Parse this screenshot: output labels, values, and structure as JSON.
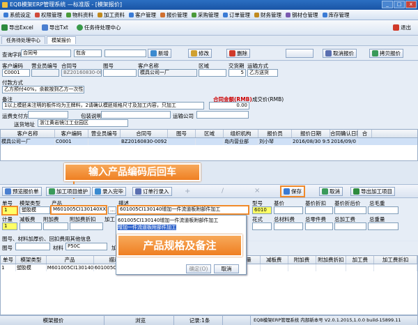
{
  "window": {
    "title": "EQB模架ERP管理系统 —标准版 - [模架报价]"
  },
  "menu": [
    {
      "label": "系统设定",
      "color": "#3a7bd5"
    },
    {
      "label": "权限管理",
      "color": "#d04a3a"
    },
    {
      "label": "物料资料",
      "color": "#4a9a3a"
    },
    {
      "label": "加工资料",
      "color": "#c08a20"
    },
    {
      "label": "客户管理",
      "color": "#3a7bd5"
    },
    {
      "label": "报价管理",
      "color": "#d07030"
    },
    {
      "label": "采购管理",
      "color": "#4a9a3a"
    },
    {
      "label": "订单管理",
      "color": "#3a7bd5"
    },
    {
      "label": "财务管理",
      "color": "#c08a20"
    },
    {
      "label": "钢材仓管理",
      "color": "#7a5ab0"
    },
    {
      "label": "库存管理",
      "color": "#3a7bd5"
    }
  ],
  "toolbar": {
    "export_excel": "导出Excel",
    "export_txt": "导出Txt",
    "task_center": "任务待处理中心",
    "exit": "退出"
  },
  "tabs": [
    "任务待处理中心",
    "模架报价"
  ],
  "query": {
    "label": "查询字段",
    "field": "合同号",
    "op": "包含",
    "value": "",
    "buttons": {
      "add": "新增",
      "edit": "修改",
      "delete": "删除",
      "cancel_quote": "取消报价",
      "copy_quote": "拷贝报价"
    }
  },
  "form": {
    "labels": {
      "customer_code": "客户编码",
      "salesman_no": "营业员编号",
      "contract_no": "合同号",
      "drawing_no": "图号",
      "customer_name": "客户名称",
      "area": "区域",
      "delivery_days": "交货期",
      "ship_method": "运输方式",
      "payment": "付款方式",
      "remark": "备注",
      "total_amount": "合同金额(RMB)",
      "deal_price": "成交价(RMB)",
      "freight_pay": "运费支付方式",
      "packing": "包装说明",
      "transport_co": "运输公司",
      "deliver_addr": "送货地址"
    },
    "customer_code": "C0001",
    "contract_no": "BZ20160830-0092",
    "customer_name": "模具公司一厂",
    "delivery_days": "5",
    "ship_method": "乙方送货",
    "payment": "乙方预付40%，余款按到乙方一次性结清",
    "remark": "1以上模胚未注明的板件均为王牌料，2请确认模胚规格尺寸及加工内容，只加工",
    "total_amount": "0.00",
    "deliver_addr": "浙江黄岩镜江工业园区"
  },
  "grid1": {
    "headers": [
      "客户名称",
      "客户编码",
      "营业员编号",
      "合同号",
      "图号",
      "区域",
      "组织机构",
      "报价员",
      "报价日期",
      "合同确认日期",
      "合"
    ],
    "rows": [
      [
        "模具公司一厂",
        "C0001",
        "",
        "BZ20160830-0092",
        "",
        "",
        "岛内营业部",
        "刘小琴",
        "2016/08/30 9:55:27",
        "2016/09/0"
      ]
    ]
  },
  "callouts": {
    "top": "输入产品编码后回车",
    "bottom": "产品规格及备注"
  },
  "detail_toolbar": {
    "pre_import": "预览报价单",
    "add_process": "加工项目维护",
    "entry_done": "录入完毕",
    "order_tasks": "订单行录入",
    "save": "保存",
    "cancel": "取消",
    "export_process": "导出加工项目"
  },
  "detail_headers1": {
    "qty": "单号",
    "type": "模架类型",
    "product": "产品",
    "spec": "描述",
    "model": "型号",
    "base_price": "基价",
    "base_discount": "基价折扣",
    "base_after": "基价折后价",
    "total_weight": "总毛重"
  },
  "detail_values1": {
    "qty": "1",
    "type": "塑胶模",
    "product": "M601005CI130140XX5",
    "spec": "601005CI130140增加一件流道板附部件加工",
    "model": "6010"
  },
  "detail_headers2": {
    "qty": "计量",
    "weight": "减板费",
    "extra": "附加费",
    "extra_discount": "附加费折扣",
    "process": "加工",
    "pattern": "花式",
    "total_material": "总材料费",
    "total_parts": "总零件费",
    "total_process": "总加工费",
    "total_gross": "总重量"
  },
  "detail_values2": {
    "qty": "1"
  },
  "spec_popup": {
    "line1": "601005CI130140增加一件流道板附部件加工",
    "line2": "增加一件流道板附部件加工",
    "ok": "确定(O)",
    "cancel": "取消"
  },
  "drawing_row": {
    "label": "图号、材料加厚价、回扣费用其他信息",
    "drawing": "图号",
    "material": "材料",
    "material_value": "P50C",
    "tax": "加工"
  },
  "grid2": {
    "headers": [
      "单号",
      "模架类型",
      "产品",
      "描述",
      "",
      "价后价",
      "数量",
      "减板费",
      "附加费",
      "附加费折扣",
      "加工费",
      "加工费折扣"
    ],
    "rows": [
      [
        "1",
        "塑胶模",
        "M601005CI130140XX5",
        "601005CI130",
        "",
        "",
        "1",
        "",
        "",
        "",
        "",
        ""
      ]
    ]
  },
  "statusbar": [
    "模架报价",
    "浏览",
    "记录:1条",
    "",
    "EQB模架ERP管理系统 内部新本号 V2.0.1.2015,1.0.0 build-15899.11"
  ]
}
